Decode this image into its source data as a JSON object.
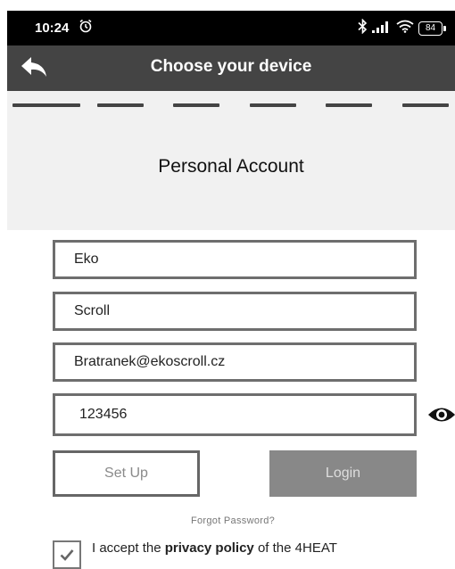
{
  "status_bar": {
    "time": "10:24",
    "battery": "84",
    "icons": [
      "alarm-icon",
      "bluetooth-icon",
      "signal-icon",
      "wifi-icon",
      "battery-icon"
    ]
  },
  "app_bar": {
    "title": "Choose your device",
    "back_icon": "back-arrow-icon"
  },
  "progress": {
    "total_steps": 6
  },
  "section": {
    "title": "Personal Account"
  },
  "form": {
    "first_name": "Eko",
    "last_name": "Scroll",
    "email": "Bratranek@ekoscroll.cz",
    "password": "123456",
    "password_toggle_icon": "eye-icon"
  },
  "buttons": {
    "setup": "Set Up",
    "login": "Login"
  },
  "links": {
    "forgot_password": "Forgot Password?"
  },
  "consent": {
    "checked": true,
    "prefix": "I accept the ",
    "policy": "privacy policy",
    "suffix": " of the 4HEAT"
  },
  "colors": {
    "app_bar": "#444444",
    "band": "#f1f1f1",
    "login_bg": "#888888",
    "border": "#6e6e6e"
  }
}
